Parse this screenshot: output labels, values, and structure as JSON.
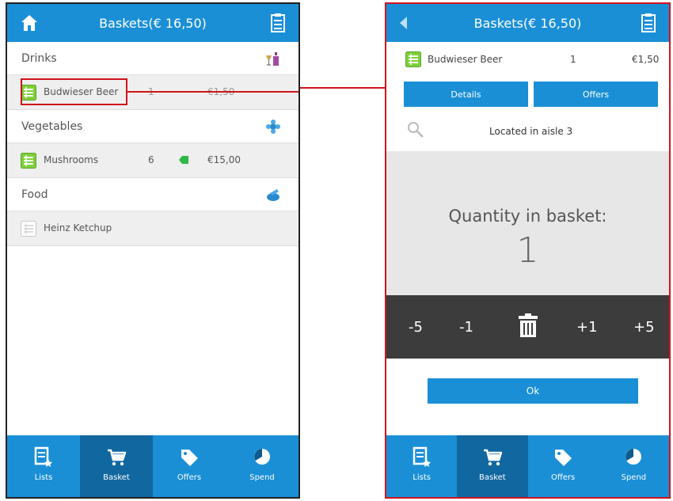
{
  "left": {
    "header_title": "Baskets(€ 16,50)",
    "sections": [
      {
        "name": "Drinks",
        "icon": "bottle-glass-icon",
        "item": {
          "name": "Budwieser Beer",
          "qty": "1",
          "price": "€1,50",
          "checked": true
        }
      },
      {
        "name": "Vegetables",
        "icon": "vegetable-icon",
        "item": {
          "name": "Mushrooms",
          "qty": "6",
          "price": "€15,00",
          "has_offer_tag": true,
          "checked": false
        }
      },
      {
        "name": "Food",
        "icon": "food-icon",
        "item": {
          "name": "Heinz Ketchup",
          "qty": "",
          "price": "",
          "checked": false
        }
      }
    ]
  },
  "right": {
    "header_title": "Baskets(€ 16,50)",
    "product": {
      "name": "Budwieser Beer",
      "qty": "1",
      "price": "€1,50"
    },
    "details_label": "Details",
    "offers_label": "Offers",
    "aisle_text": "Located in aisle 3",
    "quantity_label": "Quantity in basket:",
    "quantity_value": "1",
    "stepper": [
      "-5",
      "-1",
      "+1",
      "+5"
    ],
    "ok_label": "Ok"
  },
  "nav": [
    {
      "label": "Lists",
      "icon": "lists-icon"
    },
    {
      "label": "Basket",
      "icon": "cart-icon",
      "active": true
    },
    {
      "label": "Offers",
      "icon": "tag-icon"
    },
    {
      "label": "Spend",
      "icon": "pie-chart-icon"
    }
  ],
  "colors": {
    "accent": "#1a8fd6",
    "accent_dark": "#11679f",
    "highlight": "#d0141c",
    "stepper_bg": "#3c3c3c"
  }
}
